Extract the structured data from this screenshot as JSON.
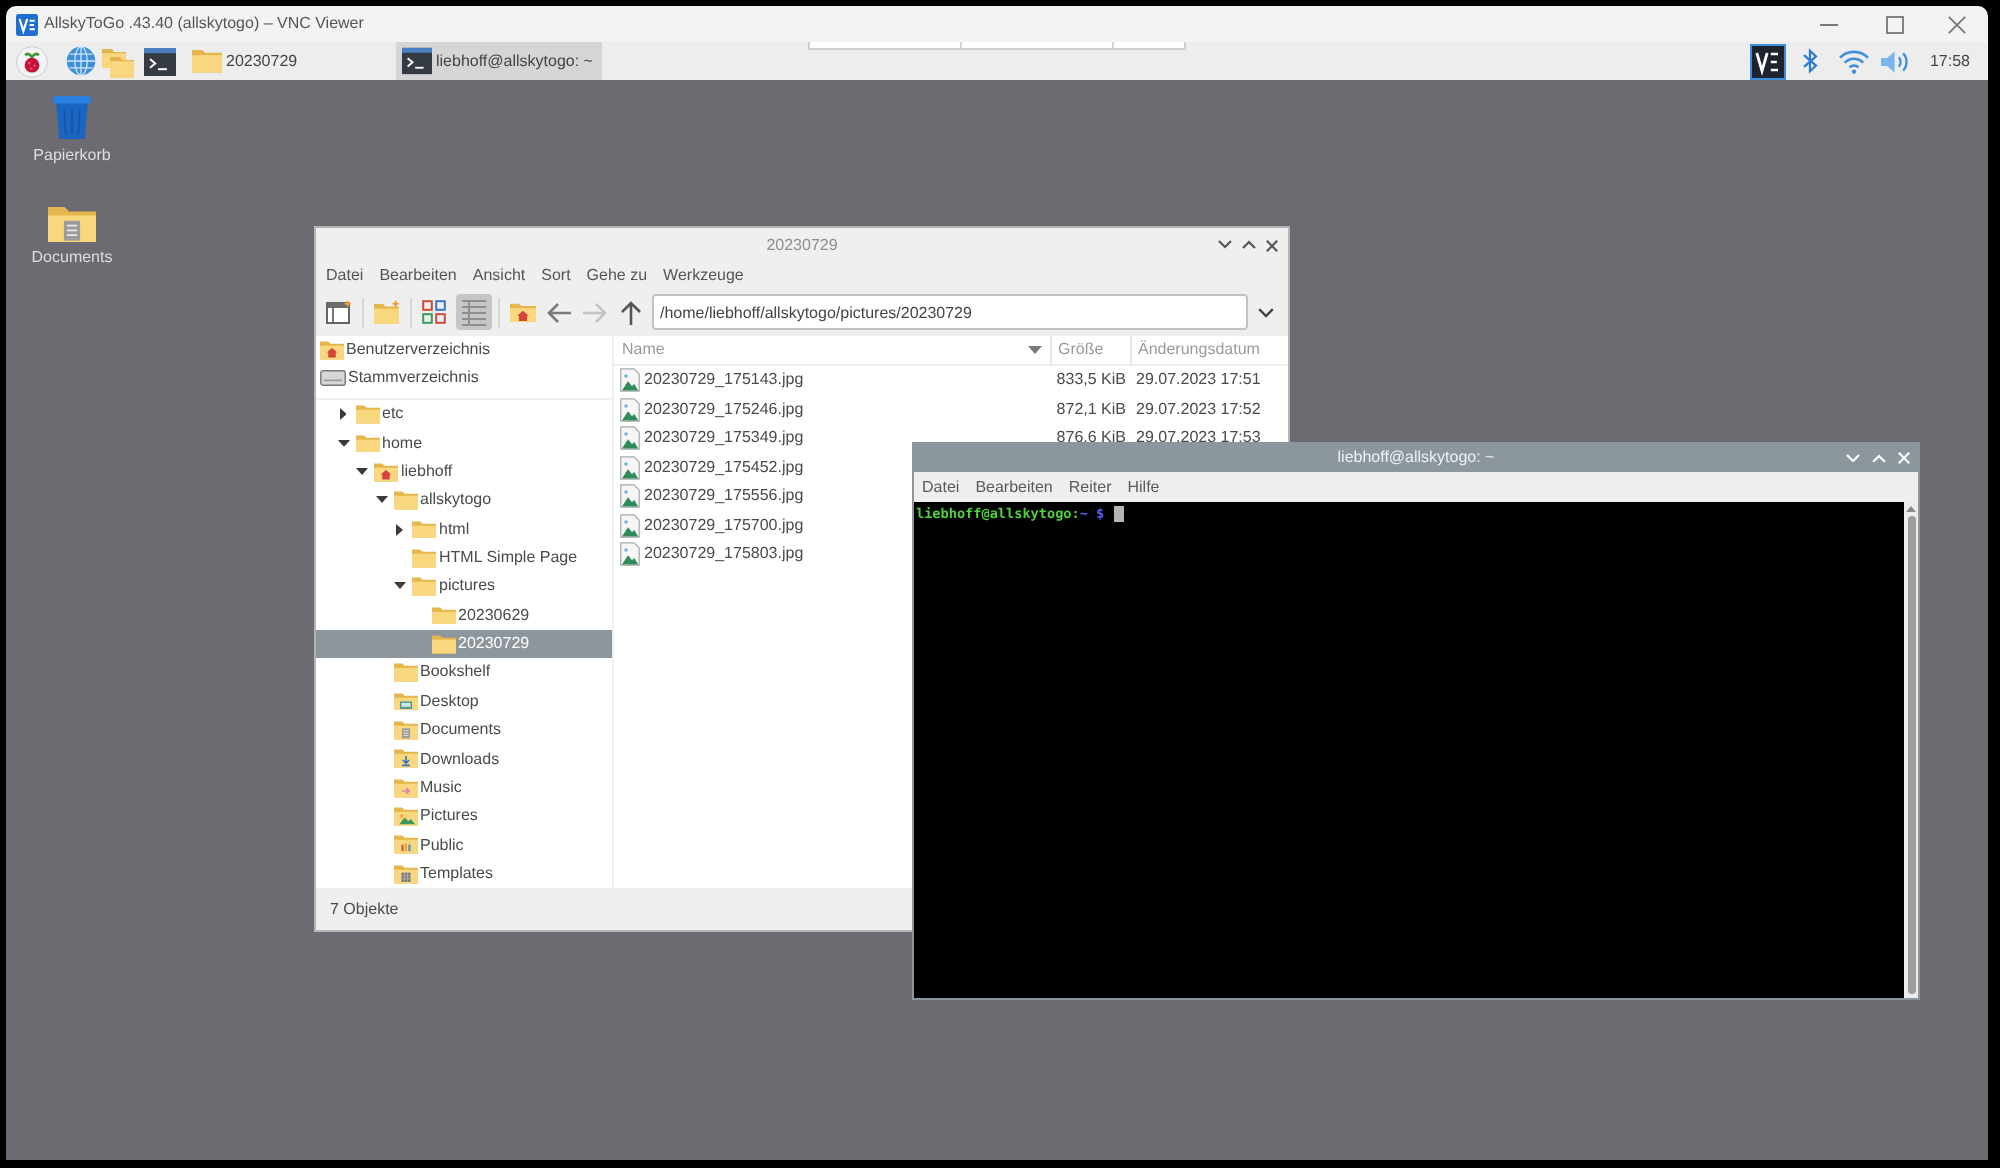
{
  "vnc_window": {
    "title": "AllskyToGo .43.40 (allskytogo) – VNC Viewer"
  },
  "taskbar": {
    "tasks": [
      {
        "label": "20230729",
        "kind": "folder",
        "selected": false
      },
      {
        "label": "liebhoff@allskytogo: ~",
        "kind": "terminal",
        "selected": true
      }
    ],
    "clock": "17:58"
  },
  "desktop_icons": [
    {
      "label": "Papierkorb",
      "kind": "trash"
    },
    {
      "label": "Documents",
      "kind": "documents"
    }
  ],
  "file_manager": {
    "title": "20230729",
    "active": false,
    "menu": [
      "Datei",
      "Bearbeiten",
      "Ansicht",
      "Sort",
      "Gehe zu",
      "Werkzeuge"
    ],
    "toolbar": {
      "view_modes": [
        {
          "kind": "icons",
          "selected": false
        },
        {
          "kind": "list",
          "selected": true
        }
      ],
      "navigation": [
        {
          "kind": "home",
          "disabled": false
        },
        {
          "kind": "back",
          "disabled": false
        },
        {
          "kind": "forward",
          "disabled": true
        },
        {
          "kind": "up",
          "disabled": false
        }
      ]
    },
    "path": "/home/liebhoff/allskytogo/pictures/20230729",
    "places": [
      {
        "label": "Benutzerverzeichnis",
        "kind": "home",
        "selected": false
      },
      {
        "label": "Stammverzeichnis",
        "kind": "drive",
        "selected": false
      }
    ],
    "tree": [
      {
        "label": "etc",
        "kind": "folder",
        "expanded": false,
        "selected": false
      },
      {
        "label": "home",
        "kind": "folder",
        "expanded": true,
        "selected": false,
        "children": [
          {
            "label": "liebhoff",
            "kind": "home",
            "expanded": true,
            "selected": false,
            "children": [
              {
                "label": "allskytogo",
                "kind": "folder",
                "expanded": true,
                "selected": false,
                "children": [
                  {
                    "label": "html",
                    "kind": "folder",
                    "expanded": false,
                    "selected": false
                  },
                  {
                    "label": "HTML Simple Page",
                    "kind": "folder",
                    "selected": false
                  },
                  {
                    "label": "pictures",
                    "kind": "folder",
                    "expanded": true,
                    "selected": false,
                    "children": [
                      {
                        "label": "20230629",
                        "kind": "folder",
                        "selected": false
                      },
                      {
                        "label": "20230729",
                        "kind": "folder",
                        "selected": true
                      }
                    ]
                  }
                ]
              },
              {
                "label": "Bookshelf",
                "kind": "folder",
                "selected": false
              },
              {
                "label": "Desktop",
                "kind": "desktop",
                "selected": false
              },
              {
                "label": "Documents",
                "kind": "documents",
                "selected": false
              },
              {
                "label": "Downloads",
                "kind": "downloads",
                "selected": false
              },
              {
                "label": "Music",
                "kind": "music",
                "selected": false
              },
              {
                "label": "Pictures",
                "kind": "pictures",
                "selected": false
              },
              {
                "label": "Public",
                "kind": "public",
                "selected": false
              },
              {
                "label": "Templates",
                "kind": "templates",
                "selected": false
              }
            ]
          }
        ]
      }
    ],
    "columns": [
      {
        "label": "Name",
        "sorted": true
      },
      {
        "label": "Größe",
        "sorted": false
      },
      {
        "label": "Änderungsdatum",
        "sorted": false
      }
    ],
    "files": [
      {
        "name": "20230729_175143.jpg",
        "size": "833,5 KiB",
        "modified": "29.07.2023 17:51",
        "selected": false
      },
      {
        "name": "20230729_175246.jpg",
        "size": "872,1 KiB",
        "modified": "29.07.2023 17:52",
        "selected": false
      },
      {
        "name": "20230729_175349.jpg",
        "size": "876,6 KiB",
        "modified": "29.07.2023 17:53",
        "selected": false
      },
      {
        "name": "20230729_175452.jpg",
        "selected": false
      },
      {
        "name": "20230729_175556.jpg",
        "selected": false
      },
      {
        "name": "20230729_175700.jpg",
        "selected": false
      },
      {
        "name": "20230729_175803.jpg",
        "selected": false
      }
    ],
    "status": "7 Objekte"
  },
  "terminal": {
    "title": "liebhoff@allskytogo: ~",
    "active": true,
    "menu": [
      "Datei",
      "Bearbeiten",
      "Reiter",
      "Hilfe"
    ],
    "prompt": {
      "user_host": "liebhoff@allskytogo:",
      "path": "~ $"
    }
  }
}
